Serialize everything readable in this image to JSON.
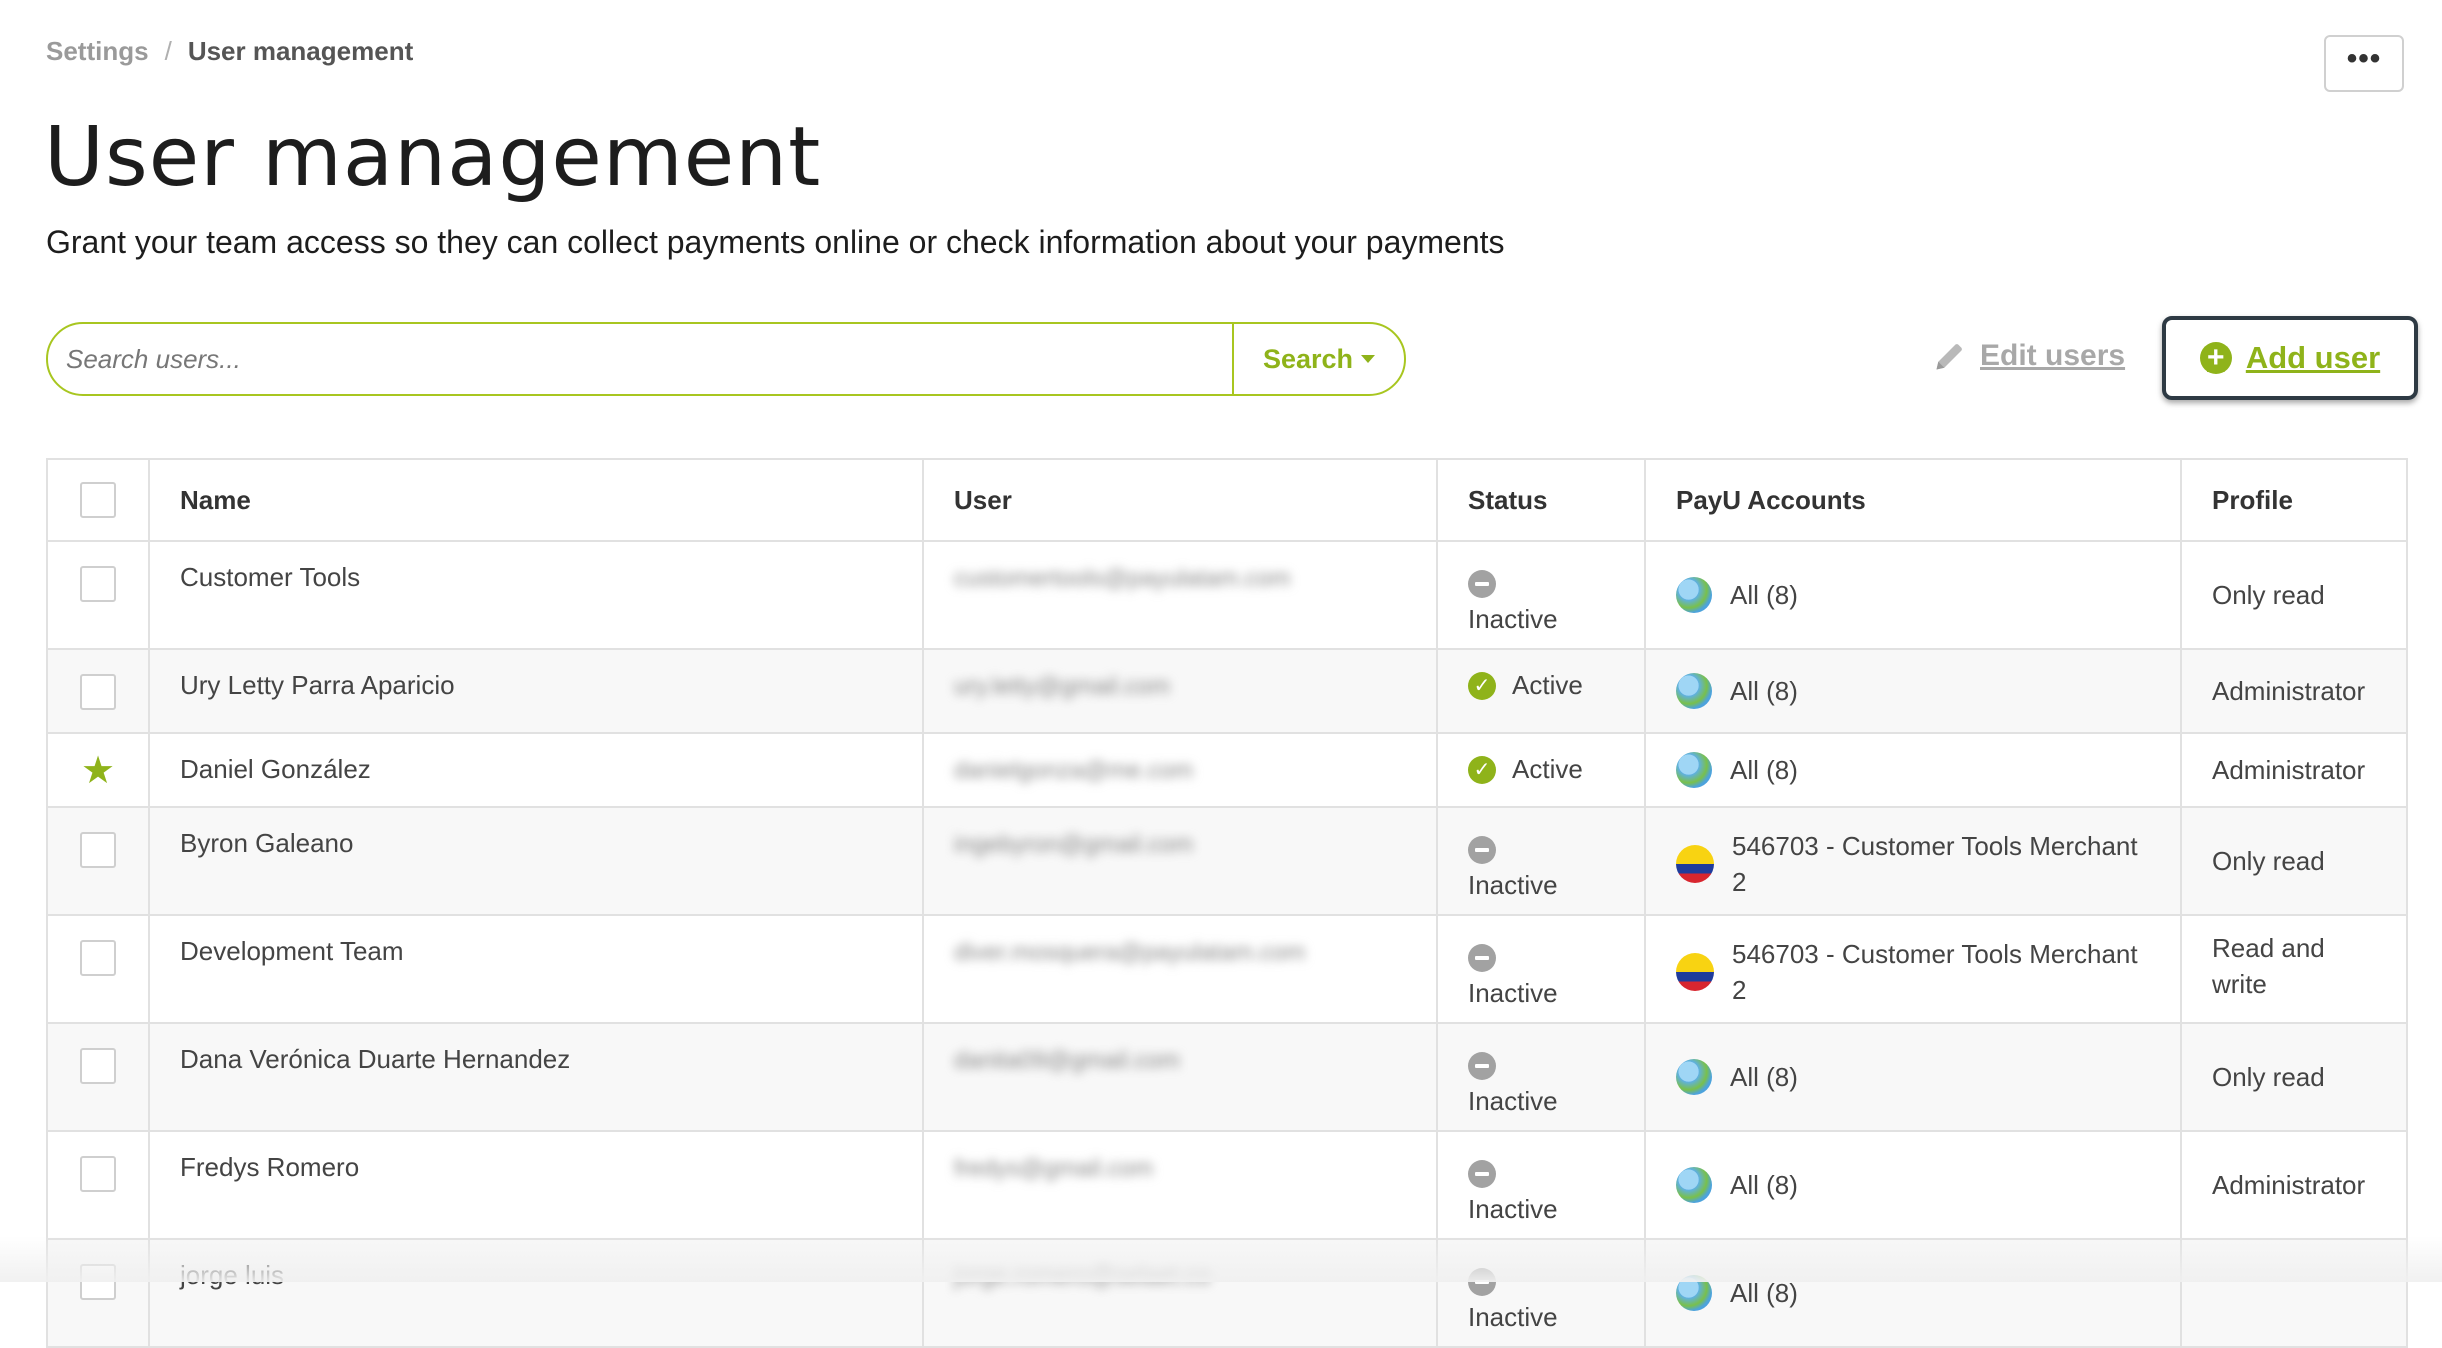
{
  "breadcrumb": {
    "parent": "Settings",
    "separator": "/",
    "current": "User management"
  },
  "header": {
    "more_label": "•••"
  },
  "page": {
    "title": "User management",
    "subtitle": "Grant your team access so they can collect payments online or check information about your payments"
  },
  "search": {
    "placeholder": "Search users...",
    "button_label": "Search"
  },
  "actions": {
    "edit_users": "Edit users",
    "add_user": "Add user",
    "add_user_icon": "+"
  },
  "colors": {
    "accent": "#8fb31a",
    "border": "#a8c620",
    "inactive": "#a2a2a2"
  },
  "table": {
    "headers": {
      "name": "Name",
      "user": "User",
      "status": "Status",
      "accounts": "PayU Accounts",
      "profile": "Profile"
    },
    "rows": [
      {
        "name": "Customer Tools",
        "user": "customertools@payulatam.com",
        "status": "Inactive",
        "account": "All (8)",
        "account_icon": "globe-icon",
        "profile": "Only read"
      },
      {
        "name": "Ury Letty Parra Aparicio",
        "user": "ury.letty@gmail.com",
        "status": "Active",
        "account": "All (8)",
        "account_icon": "globe-icon",
        "profile": "Administrator"
      },
      {
        "name": "Daniel González",
        "user": "danielgonza@me.com",
        "status": "Active",
        "account": "All (8)",
        "account_icon": "globe-icon",
        "profile": "Administrator"
      },
      {
        "name": "Byron Galeano",
        "user": "ingebyron@gmail.com",
        "status": "Inactive",
        "account": "546703 - Customer Tools Merchant 2",
        "account_icon": "colombia-flag-icon",
        "profile": "Only read"
      },
      {
        "name": "Development Team",
        "user": "diver.mosquera@payulatam.com",
        "status": "Inactive",
        "account": "546703 - Customer Tools Merchant 2",
        "account_icon": "colombia-flag-icon",
        "profile": "Read and write"
      },
      {
        "name": "Dana Verónica Duarte Hernandez",
        "user": "danita09@gmail.com",
        "status": "Inactive",
        "account": "All (8)",
        "account_icon": "globe-icon",
        "profile": "Only read"
      },
      {
        "name": "Fredys Romero",
        "user": "fredys@gmail.com",
        "status": "Inactive",
        "account": "All (8)",
        "account_icon": "globe-icon",
        "profile": "Administrator"
      },
      {
        "name": "jorge luis",
        "user": "jorge.romero@selaet.co",
        "status": "Inactive",
        "account": "All (8)",
        "account_icon": "globe-icon",
        "profile": ""
      }
    ]
  }
}
